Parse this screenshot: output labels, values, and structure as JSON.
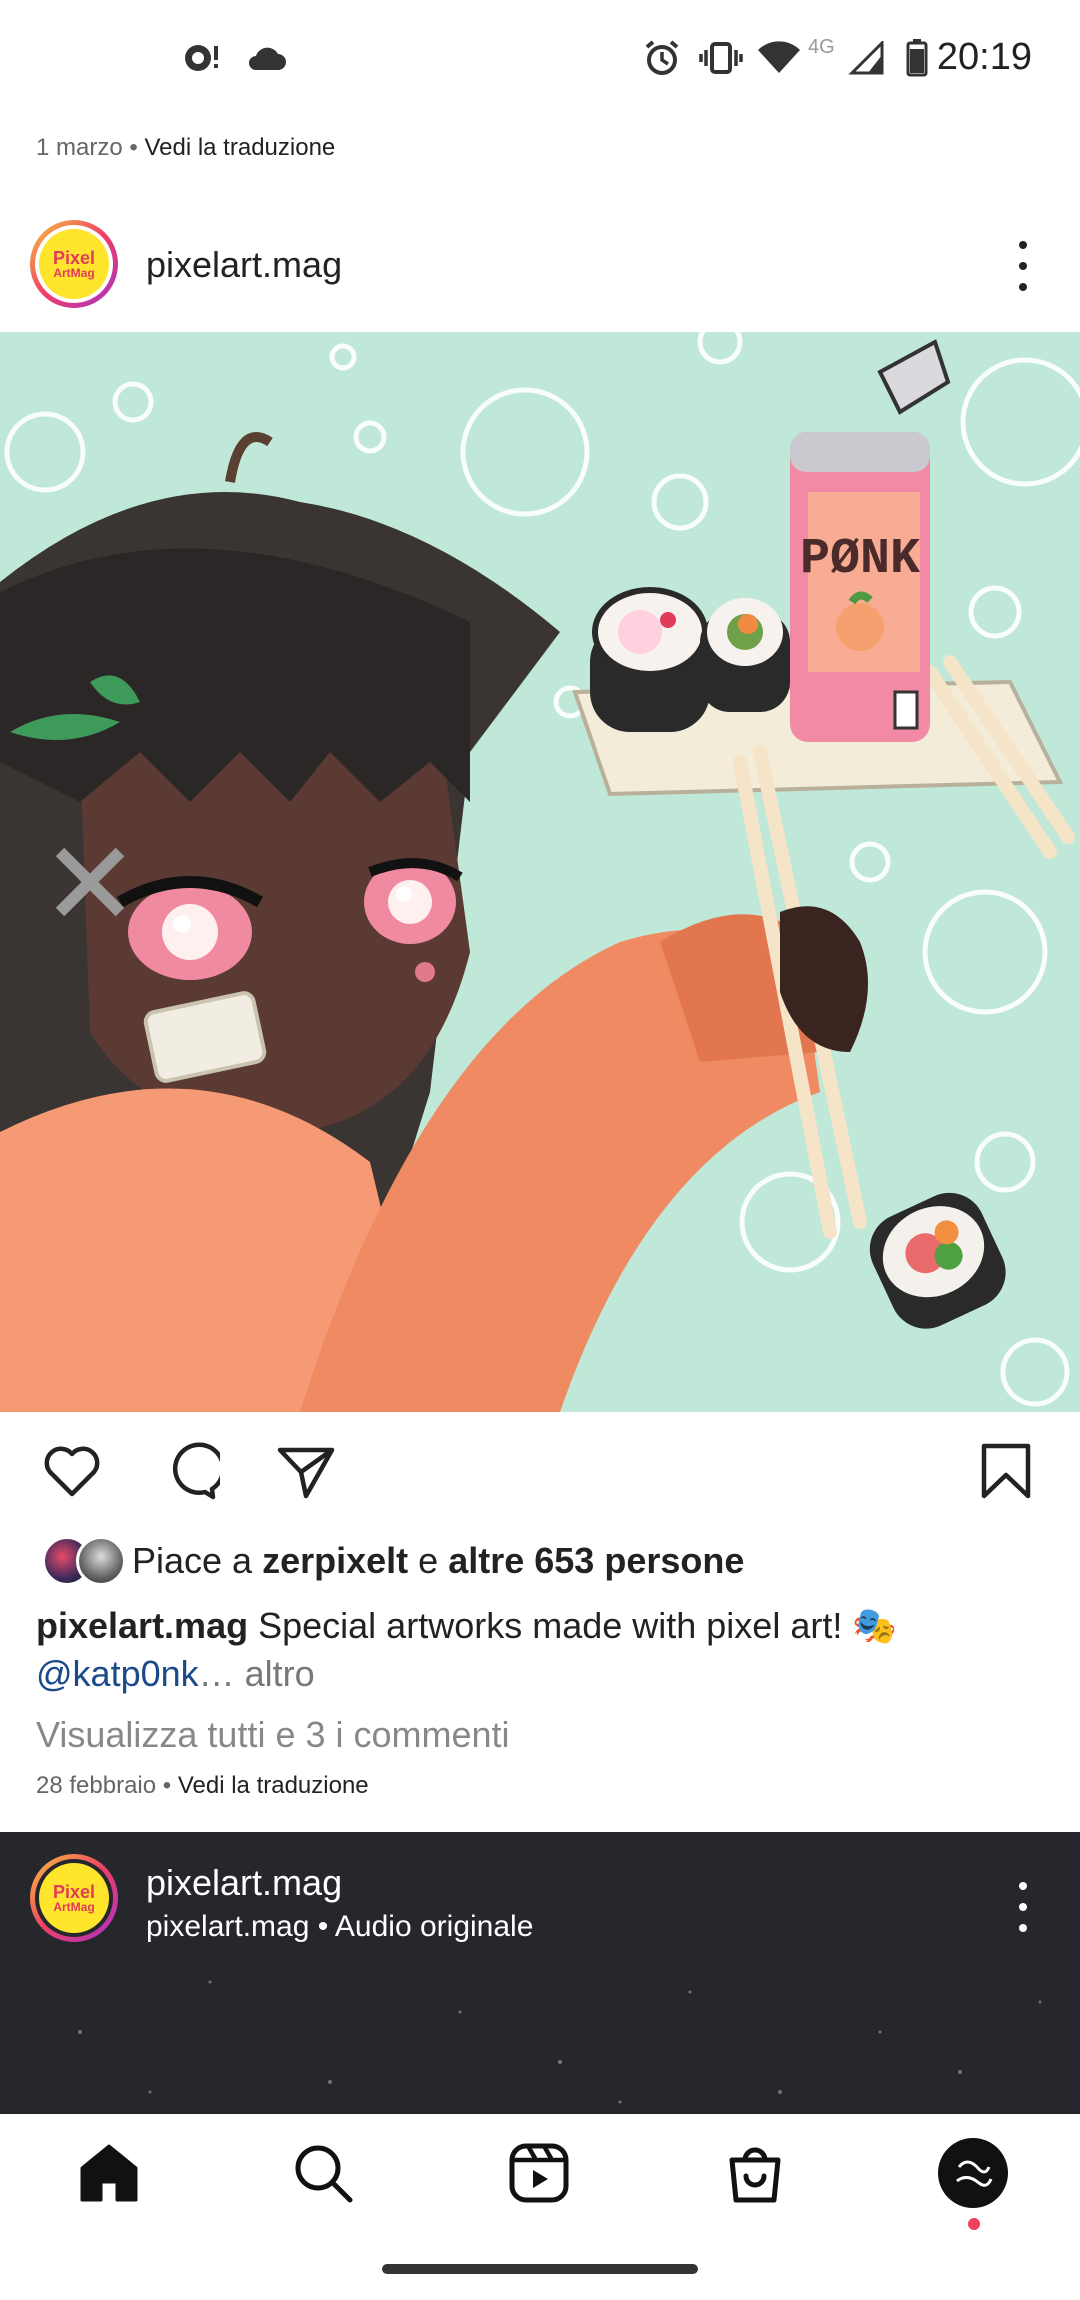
{
  "status": {
    "time": "20:19",
    "network": "4G"
  },
  "previous_post": {
    "date": "1 marzo",
    "translate": "Vedi la traduzione"
  },
  "post": {
    "username": "pixelart.mag",
    "avatar_text_top": "Pixel",
    "avatar_text_bottom": "ArtMag",
    "image_can_text": "PØNK",
    "likes_prefix": "Piace a",
    "likes_user": "zerpixelt",
    "likes_and": "e",
    "likes_others": "altre 653 persone",
    "caption_user": "pixelart.mag",
    "caption_text": "Special artworks made with pixel art! 🎭",
    "caption_mention": "@katp0nk",
    "caption_ellipsis": "…",
    "caption_more": "altro",
    "view_comments": "Visualizza tutti e 3 i commenti",
    "date": "28 febbraio",
    "translate": "Vedi la traduzione"
  },
  "reel": {
    "username": "pixelart.mag",
    "audio": "pixelart.mag • Audio originale"
  },
  "icons": {
    "like": "heart-icon",
    "comment": "comment-icon",
    "share": "send-icon",
    "save": "bookmark-icon",
    "home": "home-icon",
    "search": "search-icon",
    "reels": "reels-icon",
    "shop": "shop-icon",
    "profile": "profile-avatar"
  },
  "colors": {
    "accent_link": "#1a4a8a",
    "notification_dot": "#ee3f5b",
    "image_bg": "#bfe8d8"
  }
}
